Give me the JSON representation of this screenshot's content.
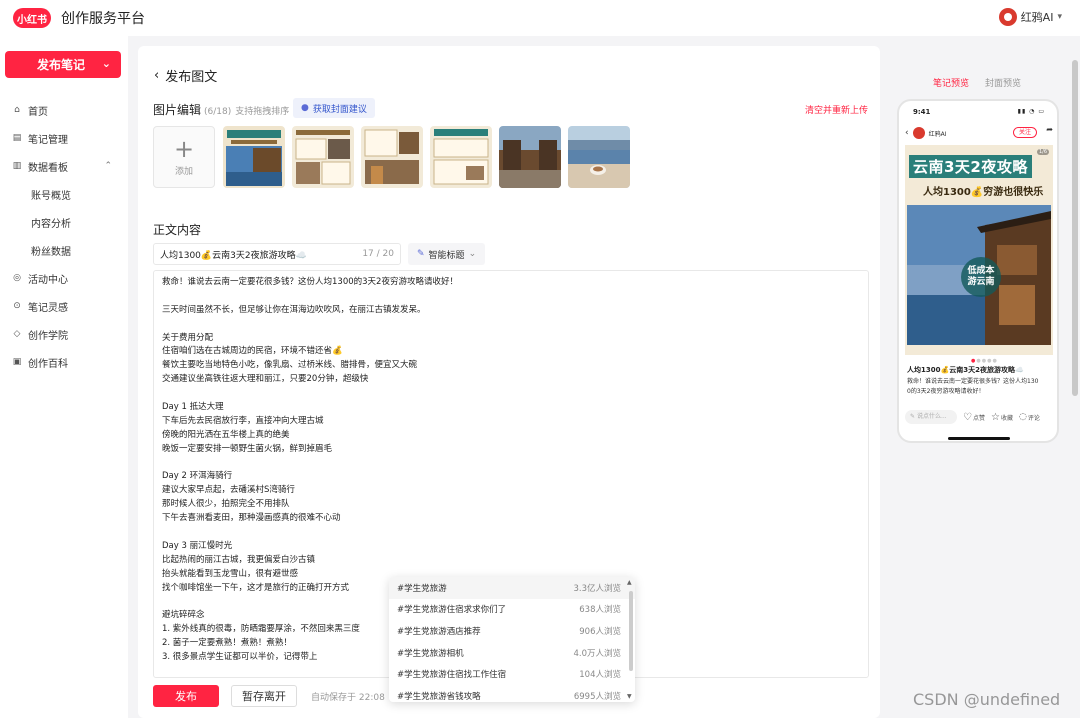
{
  "header": {
    "logo_text": "小红书",
    "title": "创作服务平台",
    "user_name": "红鸦AI"
  },
  "sidebar": {
    "publish_button": "发布笔记",
    "items": [
      {
        "label": "首页",
        "icon": "home-icon"
      },
      {
        "label": "笔记管理",
        "icon": "document-icon"
      },
      {
        "label": "数据看板",
        "icon": "chart-icon"
      },
      {
        "label": "账号概览",
        "sub": true
      },
      {
        "label": "内容分析",
        "sub": true
      },
      {
        "label": "粉丝数据",
        "sub": true
      },
      {
        "label": "活动中心",
        "icon": "target-icon"
      },
      {
        "label": "笔记灵感",
        "icon": "search-icon"
      },
      {
        "label": "创作学院",
        "icon": "cap-icon"
      },
      {
        "label": "创作百科",
        "icon": "book-icon"
      }
    ]
  },
  "editor": {
    "back_title": "发布图文",
    "image_section_title": "图片编辑",
    "image_count": "(6/18)",
    "image_hint": "支持拖拽排序",
    "cover_suggest": "获取封面建议",
    "clear_reupload": "清空并重新上传",
    "add_label": "添加",
    "body_section_title": "正文内容",
    "title_value": "人均1300💰云南3天2夜旅游攻略☁️",
    "title_count": "17 / 20",
    "smart_title": "智能标题",
    "body_lines": [
      "救命！谁说去云南一定要花很多钱？这份人均1300的3天2夜穷游攻略请收好！",
      "",
      "三天时间虽然不长，但足够让你在洱海边吹吹风，在丽江古镇发发呆。",
      "",
      "关于费用分配",
      "住宿咱们选在古城周边的民宿，环境不错还省💰",
      "餐饮主要吃当地特色小吃，像乳扇、过桥米线、腊排骨，便宜又大碗",
      "交通建议坐高铁往返大理和丽江，只要20分钟，超级快",
      "",
      "Day 1 抵达大理",
      "下车后先去民宿放行李，直接冲向大理古城",
      "傍晚的阳光洒在五华楼上真的绝美",
      "晚饭一定要安排一顿野生菌火锅，鲜到掉眉毛",
      "",
      "Day 2 环洱海骑行",
      "建议大家早点起，去磻溪村S湾骑行",
      "那时候人很少，拍照完全不用排队",
      "下午去喜洲看麦田，那种漫画感真的很难不心动",
      "",
      "Day 3 丽江慢时光",
      "比起热闹的丽江古城，我更偏爱白沙古镇",
      "抬头就能看到玉龙雪山，很有避世感",
      "找个咖啡馆坐一下午，这才是旅行的正确打开方式",
      "",
      "避坑碎碎念",
      "1. 紫外线真的很毒，防晒霜要厚涂，不然回来黑三度",
      "2. 菌子一定要煮熟！煮熟！煮熟！",
      "3. 很多景点学生证都可以半价，记得带上"
    ],
    "publish": "发布",
    "save_draft": "暂存离开",
    "autosave": "自动保存于 22:08"
  },
  "hashtag_dropdown": [
    {
      "tag": "#学生党旅游",
      "count": "3.3亿人浏览"
    },
    {
      "tag": "#学生党旅游住宿求求你们了",
      "count": "638人浏览"
    },
    {
      "tag": "#学生党旅游酒店推荐",
      "count": "906人浏览"
    },
    {
      "tag": "#学生党旅游相机",
      "count": "4.0万人浏览"
    },
    {
      "tag": "#学生党旅游住宿找工作住宿",
      "count": "104人浏览"
    },
    {
      "tag": "#学生党旅游省钱攻略",
      "count": "6995人浏览"
    }
  ],
  "preview": {
    "tab_note": "笔记预览",
    "tab_cover": "封面预览",
    "time": "9:41",
    "author": "红鸦AI",
    "follow": "关注",
    "card_title": "云南3天2夜攻略",
    "card_subtitle": "人均1300💰穷游也很快乐",
    "badge_line1": "低成本",
    "badge_line2": "游云南",
    "page_indicator": "1/6",
    "note_title": "人均1300💰云南3天2夜旅游攻略☁️",
    "note_body_1": "救命！谁说去云南一定要花很多钱？这份人均130",
    "note_body_2": "0的3天2夜穷游攻略请收好！",
    "comment_placeholder": "说点什么...",
    "like": "点赞",
    "collect": "收藏",
    "comment": "评论"
  },
  "watermark": "CSDN @undefined",
  "colors": {
    "brand": "#ff2442",
    "link_blue": "#3355cc"
  }
}
